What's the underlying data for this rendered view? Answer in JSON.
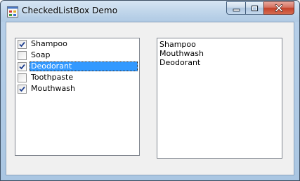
{
  "window": {
    "title": "CheckedListBox Demo"
  },
  "checked_list": {
    "items": [
      {
        "label": "Shampoo",
        "checked": true,
        "selected": false
      },
      {
        "label": "Soap",
        "checked": false,
        "selected": false
      },
      {
        "label": "Deodorant",
        "checked": true,
        "selected": true
      },
      {
        "label": "Toothpaste",
        "checked": false,
        "selected": false
      },
      {
        "label": "Mouthwash",
        "checked": true,
        "selected": false
      }
    ]
  },
  "selected_list": {
    "items": [
      "Shampoo",
      "Mouthwash",
      "Deodorant"
    ]
  },
  "icons": {
    "app": "app-icon",
    "minimize": "minimize-icon",
    "maximize": "maximize-icon",
    "close": "close-icon",
    "check": "checkmark-icon"
  },
  "colors": {
    "selection": "#3399ff",
    "close_button": "#c4412a"
  }
}
